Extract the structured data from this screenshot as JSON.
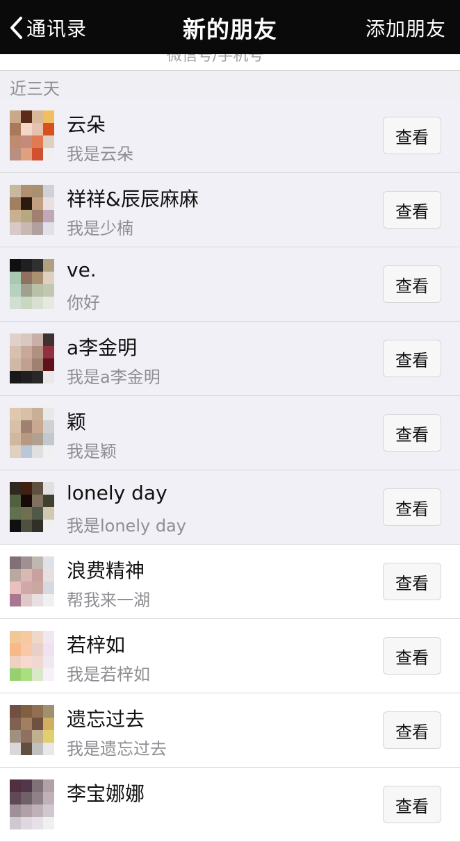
{
  "nav": {
    "back_label": "通讯录",
    "title": "新的朋友",
    "right_action": "添加朋友"
  },
  "search_strip_text": "微信号/手机号",
  "section": {
    "label": "近三天"
  },
  "icons": {
    "back": "chevron-left-icon"
  },
  "colors": {
    "navbar": "#0a0a0a",
    "section_bg": "#efeff4",
    "tinted_row": "#f0f0f6",
    "secondary_text": "#8e8e93"
  },
  "friend_requests": [
    {
      "name": "云朵",
      "message": "我是云朵",
      "button": "查看",
      "tinted": true,
      "avatar": [
        "#c9a98a",
        "#5a2a1a",
        "#d8b89a",
        "#f0c060",
        "#a87a5a",
        "#f5d5c5",
        "#e8c0b0",
        "#d9501f",
        "#c08a70",
        "#c48a7a",
        "#e07a50",
        "#e0d0c0",
        "#b89080",
        "#e0a080",
        "#d05030",
        "#f0f0f0"
      ]
    },
    {
      "name": "祥祥&辰辰麻麻",
      "message": "我是少楠",
      "button": "查看",
      "tinted": true,
      "avatar": [
        "#c8b8a0",
        "#b09070",
        "#a89070",
        "#d0d0d8",
        "#a08060",
        "#2a1a10",
        "#c0a080",
        "#e8e0e0",
        "#c8b090",
        "#b8a880",
        "#a08070",
        "#c0a8b8",
        "#d8c8c8",
        "#c8b8b0",
        "#b0a0a0",
        "#e0e0e8"
      ]
    },
    {
      "name": "ve.",
      "message": "你好",
      "button": "查看",
      "tinted": true,
      "avatar": [
        "#101010",
        "#202020",
        "#303030",
        "#b0a080",
        "#a8c8b0",
        "#907060",
        "#a89070",
        "#e0d0c0",
        "#b8d0c0",
        "#a0a090",
        "#b8c0a8",
        "#c0c8b0",
        "#d0e0d0",
        "#c8d8c0",
        "#d8e0d0",
        "#e8e8e0"
      ]
    },
    {
      "name": "a李金明",
      "message": "我是a李金明",
      "button": "查看",
      "tinted": true,
      "avatar": [
        "#e0d0c8",
        "#d8c8c0",
        "#c8b0a8",
        "#403030",
        "#d8c0b0",
        "#c8a898",
        "#b09080",
        "#903040",
        "#d0b8a8",
        "#c0a090",
        "#a08070",
        "#601018",
        "#181818",
        "#202020",
        "#282828",
        "#e8e8e8"
      ]
    },
    {
      "name": "颖",
      "message": "我是颖",
      "button": "查看",
      "tinted": true,
      "avatar": [
        "#e0c8b0",
        "#d8c0a8",
        "#c8b098",
        "#e8e8e8",
        "#d8c0a8",
        "#a08070",
        "#c8a890",
        "#d0d0d0",
        "#d0b8a0",
        "#b89880",
        "#b0a090",
        "#c0c8d0",
        "#e0d0c0",
        "#b8c8d8",
        "#e0e0e0",
        "#f0f0f0"
      ]
    },
    {
      "name": "lonely day",
      "message": "我是lonely day",
      "button": "查看",
      "tinted": true,
      "avatar": [
        "#302820",
        "#402010",
        "#605040",
        "#e0e0e0",
        "#506040",
        "#180808",
        "#807060",
        "#404030",
        "#607050",
        "#707050",
        "#505848",
        "#d0c8b0",
        "#101010",
        "#505040",
        "#303028",
        "#f0f0f0"
      ]
    },
    {
      "name": "浪费精神",
      "message": "帮我来一湖",
      "button": "查看",
      "tinted": false,
      "avatar": [
        "#807078",
        "#a09090",
        "#c0b8b0",
        "#e0e0e8",
        "#b8a8a0",
        "#d8b8b0",
        "#c8a0a0",
        "#e8e0e0",
        "#e8c0c0",
        "#d0a8a8",
        "#c8a8a0",
        "#d8d8e0",
        "#a87890",
        "#e0c8c8",
        "#e8e0e0",
        "#f0f0f0"
      ]
    },
    {
      "name": "若梓如",
      "message": "我是若梓如",
      "button": "查看",
      "tinted": false,
      "avatar": [
        "#f0c898",
        "#f8c8a0",
        "#f0d8c8",
        "#f0e8f0",
        "#f8b888",
        "#f8c8a8",
        "#e8d0c8",
        "#f0e0f0",
        "#f0d0c0",
        "#f8d8d0",
        "#f0d8d0",
        "#f0e8f0",
        "#98d070",
        "#a8e080",
        "#d8e8c8",
        "#f8f0f8"
      ]
    },
    {
      "name": "遗忘过去",
      "message": "我是遗忘过去",
      "button": "查看",
      "tinted": false,
      "avatar": [
        "#705040",
        "#806040",
        "#907050",
        "#a09070",
        "#806050",
        "#a08060",
        "#705040",
        "#d0b060",
        "#a09080",
        "#907060",
        "#c0b090",
        "#e0d070",
        "#d8d8d8",
        "#605040",
        "#c0c0c0",
        "#e8e8e8"
      ]
    },
    {
      "name": "李宝娜娜",
      "message": "",
      "button": "查看",
      "tinted": false,
      "avatar": [
        "#503040",
        "#503848",
        "#807078",
        "#b0a0a8",
        "#604858",
        "#706068",
        "#908088",
        "#c0b0b8",
        "#a09098",
        "#b0a0a8",
        "#c0b0b8",
        "#d0c8d0",
        "#d0c8d0",
        "#e0d8e0",
        "#e8e0e8",
        "#f0f0f0"
      ]
    }
  ]
}
